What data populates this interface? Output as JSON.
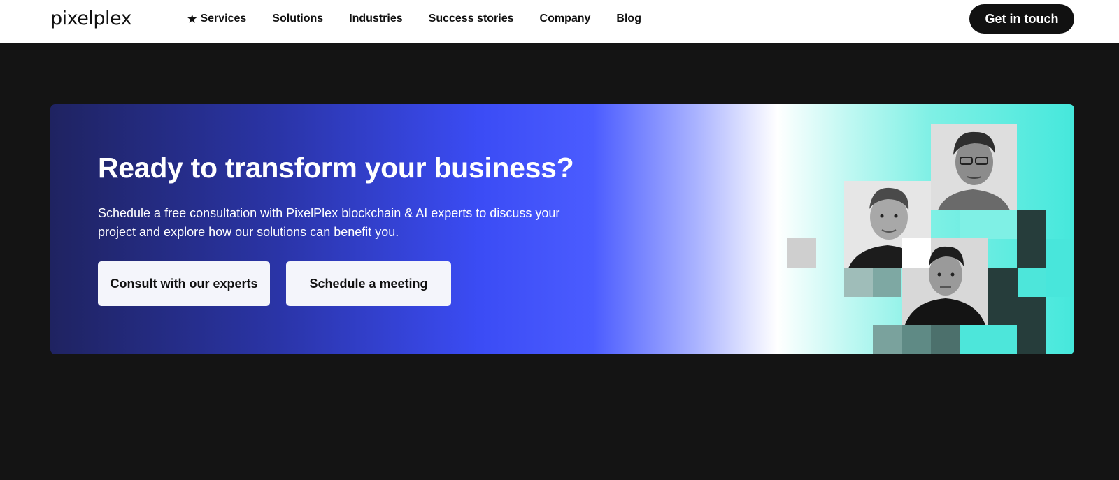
{
  "header": {
    "logo": "pixelplex",
    "nav": [
      {
        "label": "Services",
        "icon": "star-icon"
      },
      {
        "label": "Solutions"
      },
      {
        "label": "Industries"
      },
      {
        "label": "Success stories"
      },
      {
        "label": "Company"
      },
      {
        "label": "Blog"
      }
    ],
    "cta_label": "Get in touch"
  },
  "banner": {
    "headline": "Ready to transform your business?",
    "subtext": "Schedule a free consultation with PixelPlex blockchain & AI experts to discuss your project and explore how our solutions can benefit you.",
    "buttons": {
      "consult": "Consult with our experts",
      "meeting": "Schedule a meeting"
    }
  },
  "colors": {
    "page_bg": "#141414",
    "header_bg": "#ffffff",
    "cta_bg": "#111111",
    "gradient_dark": "#1f2361",
    "gradient_blue": "#3b4cf5",
    "gradient_teal": "#45e8dc"
  }
}
